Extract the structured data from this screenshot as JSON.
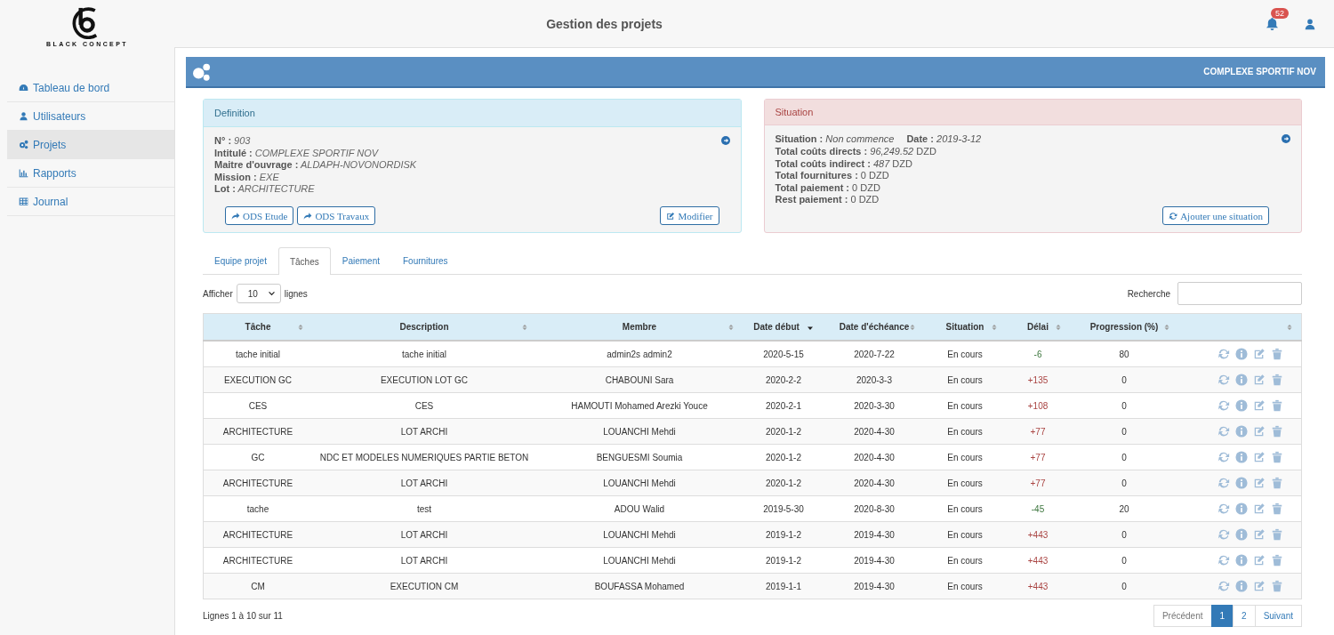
{
  "brand": {
    "name": "BLACK CONCEPT"
  },
  "header": {
    "title": "Gestion des projets",
    "notifications": "52"
  },
  "sidebar": {
    "items": [
      {
        "label": "Tableau de bord",
        "selected": false
      },
      {
        "label": "Utilisateurs",
        "selected": false
      },
      {
        "label": "Projets",
        "selected": true
      },
      {
        "label": "Rapports",
        "selected": false
      },
      {
        "label": "Journal",
        "selected": false
      }
    ]
  },
  "project_bar": {
    "title": "COMPLEXE SPORTIF NOV"
  },
  "definition": {
    "title": "Definition",
    "fields": [
      {
        "label": "N° :",
        "value": "903"
      },
      {
        "label": "Intitulé :",
        "value": "COMPLEXE SPORTIF NOV"
      },
      {
        "label": "Maitre d'ouvrage :",
        "value": "ALDAPH-NOVONORDISK"
      },
      {
        "label": "Mission :",
        "value": "EXE"
      },
      {
        "label": "Lot :",
        "value": "ARCHITECTURE"
      }
    ],
    "buttons": [
      {
        "label": "ODS Etude"
      },
      {
        "label": "ODS Travaux"
      }
    ],
    "edit_button": "Modifier"
  },
  "situation": {
    "title": "Situation",
    "lines": [
      [
        {
          "label": "Situation :",
          "value": "*Non commence*"
        },
        {
          "label": "Date :",
          "value": "*2019-3-12*"
        }
      ],
      [
        {
          "label": "Total coûts directs :",
          "value": "*96,249.52* DZD"
        }
      ],
      [
        {
          "label": "Total coûts indirect :",
          "value": "*487* DZD"
        }
      ],
      [
        {
          "label": "Total fournitures :",
          "value": "0 DZD"
        }
      ],
      [
        {
          "label": "Total paiement :",
          "value": "0 DZD"
        }
      ],
      [
        {
          "label": "Rest paiement :",
          "value": "0 DZD"
        }
      ]
    ],
    "add_button": "Ajouter une situation"
  },
  "tabs": [
    {
      "label": "Equipe projet",
      "selected": false
    },
    {
      "label": "Tâches",
      "selected": true
    },
    {
      "label": "Paiement",
      "selected": false
    },
    {
      "label": "Fournitures",
      "selected": false
    }
  ],
  "table_controls": {
    "show_label": "Afficher",
    "page_size": "10",
    "rows_label": "lignes",
    "search_label": "Recherche"
  },
  "table": {
    "columns": [
      {
        "label": "Tâche",
        "sorted": false
      },
      {
        "label": "Description",
        "sorted": false
      },
      {
        "label": "Membre",
        "sorted": false
      },
      {
        "label": "Date début",
        "sorted": true
      },
      {
        "label": "Date d'échéance",
        "sorted": false
      },
      {
        "label": "Situation",
        "sorted": false
      },
      {
        "label": "Délai",
        "sorted": false
      },
      {
        "label": "Progression (%)",
        "sorted": false
      },
      {
        "sorted": false
      }
    ],
    "rows": [
      {
        "task": "tache initial",
        "description": "tache initial",
        "member": "admin2s admin2",
        "start": "2020-5-15",
        "due": "2020-7-22",
        "situation": "En cours",
        "delay": "-6",
        "late": false,
        "progress": "80"
      },
      {
        "task": "EXECUTION GC",
        "description": "EXECUTION LOT GC",
        "member": "CHABOUNI Sara",
        "start": "2020-2-2",
        "due": "2020-3-3",
        "situation": "En cours",
        "delay": "+135",
        "late": true,
        "progress": "0"
      },
      {
        "task": "CES",
        "description": "CES",
        "member": "HAMOUTI Mohamed Arezki Youce",
        "start": "2020-2-1",
        "due": "2020-3-30",
        "situation": "En cours",
        "delay": "+108",
        "late": true,
        "progress": "0"
      },
      {
        "task": "ARCHITECTURE",
        "description": "LOT ARCHI",
        "member": "LOUANCHI Mehdi",
        "start": "2020-1-2",
        "due": "2020-4-30",
        "situation": "En cours",
        "delay": "+77",
        "late": true,
        "progress": "0"
      },
      {
        "task": "GC",
        "description": "NDC ET MODELES NUMERIQUES PARTIE BETON",
        "member": "BENGUESMI Soumia",
        "start": "2020-1-2",
        "due": "2020-4-30",
        "situation": "En cours",
        "delay": "+77",
        "late": true,
        "progress": "0"
      },
      {
        "task": "ARCHITECTURE",
        "description": "LOT ARCHI",
        "member": "LOUANCHI Mehdi",
        "start": "2020-1-2",
        "due": "2020-4-30",
        "situation": "En cours",
        "delay": "+77",
        "late": true,
        "progress": "0"
      },
      {
        "task": "tache",
        "description": "test",
        "member": "ADOU Walid",
        "start": "2019-5-30",
        "due": "2020-8-30",
        "situation": "En cours",
        "delay": "-45",
        "late": false,
        "progress": "20"
      },
      {
        "task": "ARCHITECTURE",
        "description": "LOT ARCHI",
        "member": "LOUANCHI Mehdi",
        "start": "2019-1-2",
        "due": "2019-4-30",
        "situation": "En cours",
        "delay": "+443",
        "late": true,
        "progress": "0"
      },
      {
        "task": "ARCHITECTURE",
        "description": "LOT ARCHI",
        "member": "LOUANCHI Mehdi",
        "start": "2019-1-2",
        "due": "2019-4-30",
        "situation": "En cours",
        "delay": "+443",
        "late": true,
        "progress": "0"
      },
      {
        "task": "CM",
        "description": "EXECUTION CM",
        "member": "BOUFASSA Mohamed",
        "start": "2019-1-1",
        "due": "2019-4-30",
        "situation": "En cours",
        "delay": "+443",
        "late": true,
        "progress": "0"
      }
    ]
  },
  "footer": {
    "info": "Lignes 1 à 10 sur 11",
    "pagination": [
      {
        "label": "Précédent",
        "selected": false
      },
      {
        "label": "1",
        "selected": true
      },
      {
        "label": "2",
        "selected": false
      },
      {
        "label": "Suivant",
        "selected": false
      }
    ]
  }
}
